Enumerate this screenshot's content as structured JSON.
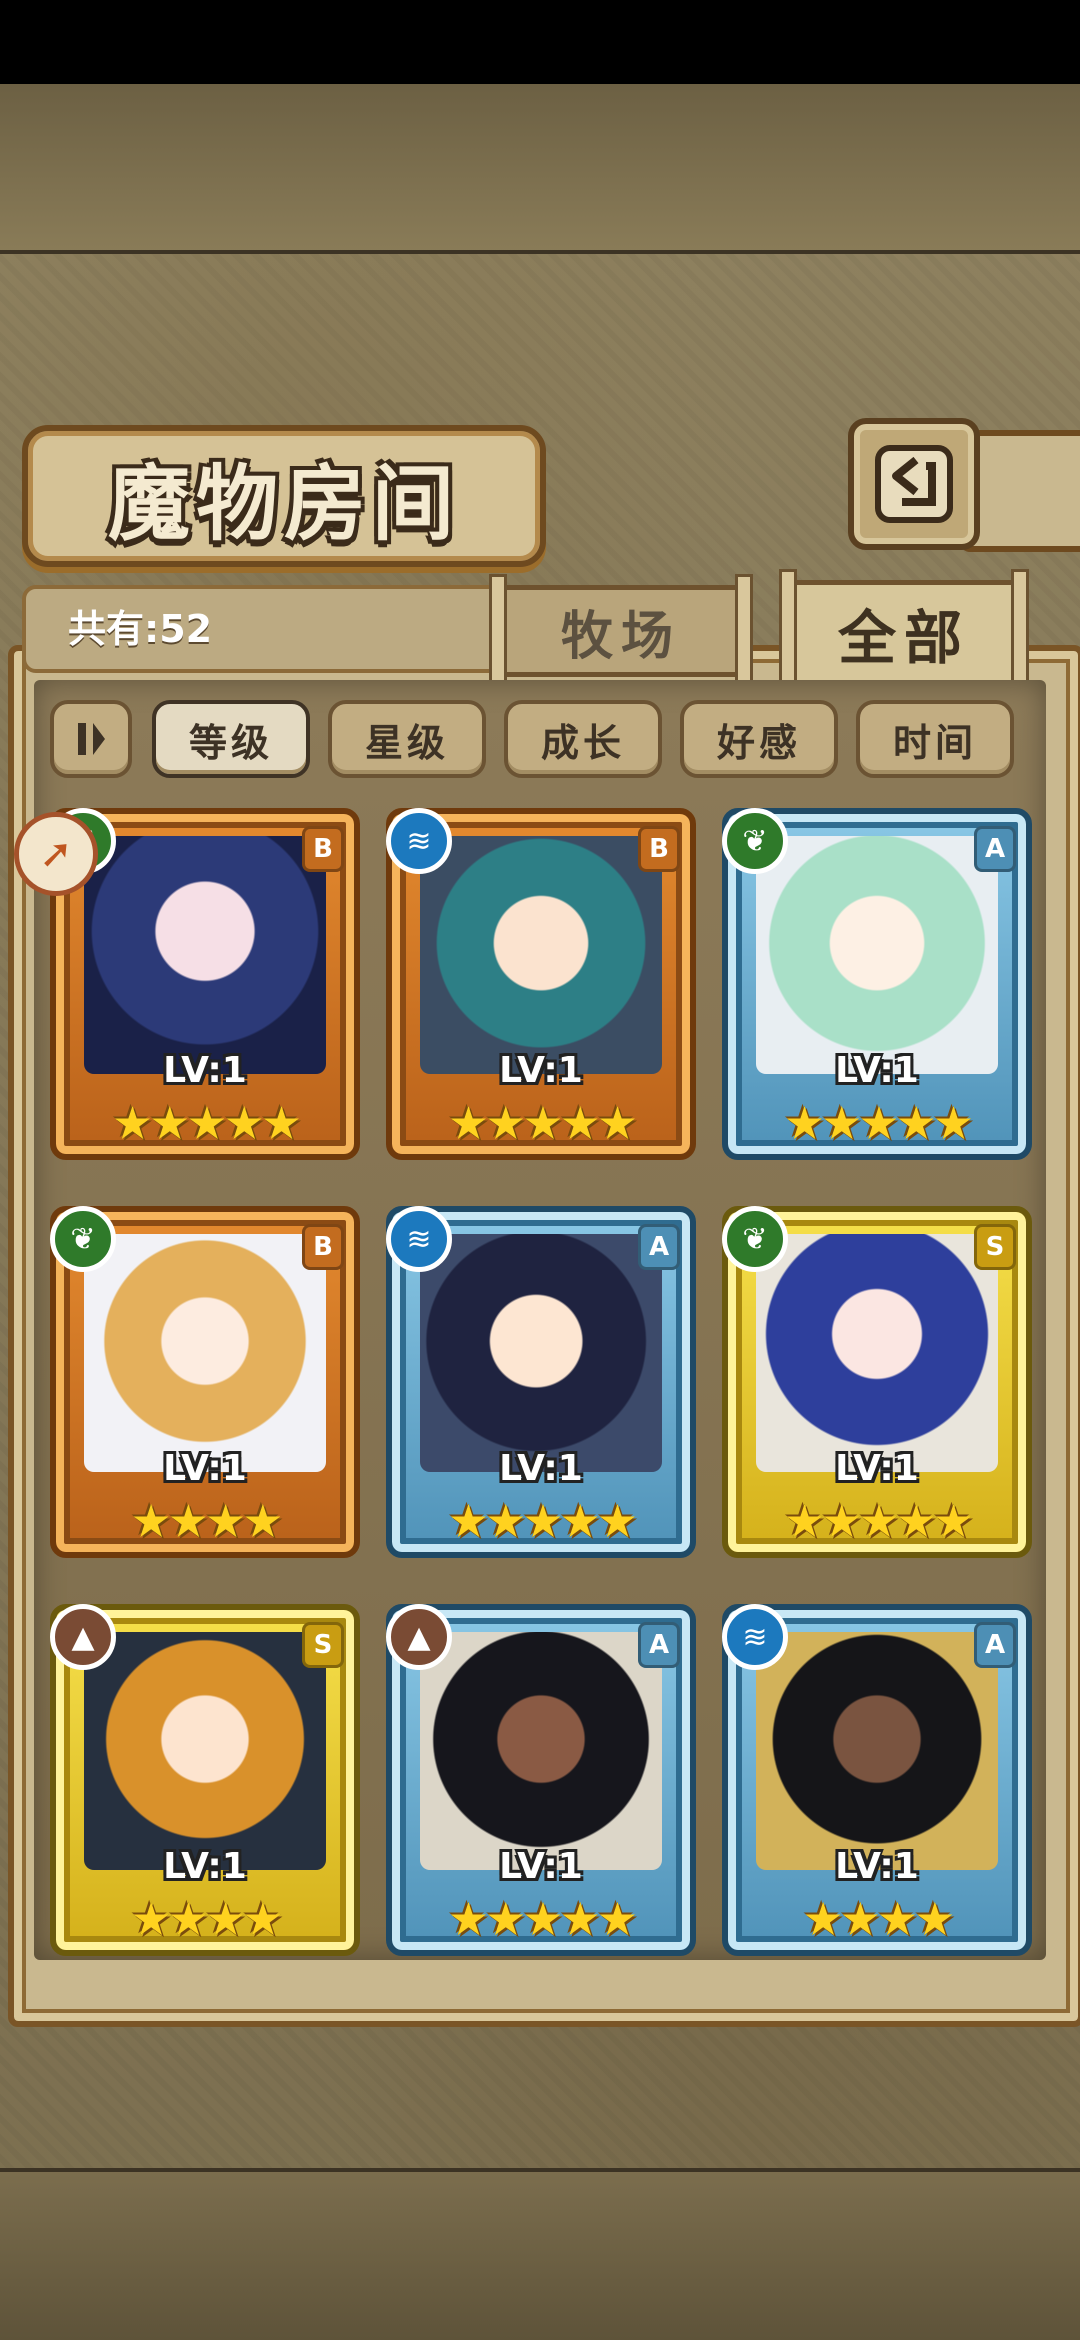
{
  "header": {
    "title": "魔物房间",
    "back_icon": "back-arrow-icon"
  },
  "count": {
    "text": "共有:52"
  },
  "tabs": [
    {
      "label": "牧场",
      "active": false
    },
    {
      "label": "全部",
      "active": true
    }
  ],
  "sort": {
    "toggle_icon": "pause-toggle-icon",
    "buttons": [
      {
        "label": "等级",
        "active": true
      },
      {
        "label": "星级",
        "active": false
      },
      {
        "label": "成长",
        "active": false
      },
      {
        "label": "好感",
        "active": false
      },
      {
        "label": "时间",
        "active": false
      }
    ]
  },
  "cards": [
    {
      "rank": "B",
      "level": "LV:1",
      "stars": "★★★★★",
      "frame": "orange",
      "element": "leaf-icon",
      "star_count": 5
    },
    {
      "rank": "B",
      "level": "LV:1",
      "stars": "★★★★★",
      "frame": "orange",
      "element": "water-icon",
      "star_count": 5
    },
    {
      "rank": "A",
      "level": "LV:1",
      "stars": "★★★★★",
      "frame": "blue",
      "element": "leaf-icon",
      "star_count": 5
    },
    {
      "rank": "B",
      "level": "LV:1",
      "stars": "★★★★",
      "frame": "orange",
      "element": "leaf-icon",
      "star_count": 4
    },
    {
      "rank": "A",
      "level": "LV:1",
      "stars": "★★★★★",
      "frame": "blue",
      "element": "water-icon",
      "star_count": 5
    },
    {
      "rank": "S",
      "level": "LV:1",
      "stars": "★★★★★",
      "frame": "gold",
      "element": "leaf-icon",
      "star_count": 5
    },
    {
      "rank": "S",
      "level": "LV:1",
      "stars": "★★★★",
      "frame": "gold",
      "element": "earth-icon",
      "star_count": 4
    },
    {
      "rank": "A",
      "level": "LV:1",
      "stars": "★★★★★",
      "frame": "blue",
      "element": "earth-icon",
      "star_count": 5
    },
    {
      "rank": "A",
      "level": "LV:1",
      "stars": "★★★★",
      "frame": "blue",
      "element": "water-icon",
      "star_count": 4
    }
  ],
  "colors": {
    "orange_frame": "#e48a2f",
    "blue_frame": "#8ac8e6",
    "gold_frame": "#f6e04b",
    "star": "#ffd21f"
  }
}
